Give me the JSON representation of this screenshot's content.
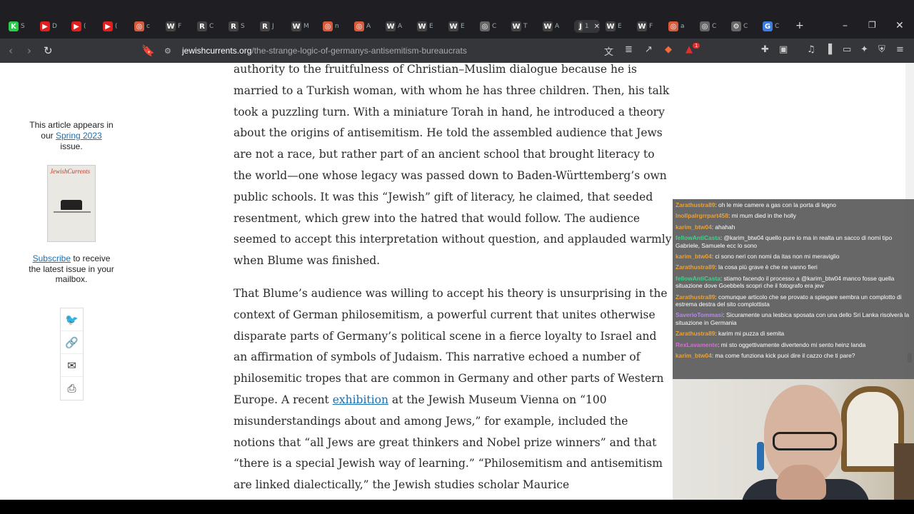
{
  "browser": {
    "tabs": [
      {
        "icon": "K",
        "color": "#2bcc4a",
        "letter": "S"
      },
      {
        "icon": "▶",
        "color": "#e02020",
        "letter": "D"
      },
      {
        "icon": "▶",
        "color": "#e02020",
        "letter": "("
      },
      {
        "icon": "▶",
        "color": "#e02020",
        "letter": "("
      },
      {
        "icon": "◎",
        "color": "#d95a3a",
        "letter": "c"
      },
      {
        "icon": "W",
        "color": "#444",
        "letter": "F"
      },
      {
        "icon": "R",
        "color": "#444",
        "letter": "C"
      },
      {
        "icon": "R",
        "color": "#444",
        "letter": "S"
      },
      {
        "icon": "R",
        "color": "#444",
        "letter": "J"
      },
      {
        "icon": "W",
        "color": "#444",
        "letter": "M"
      },
      {
        "icon": "◎",
        "color": "#d95a3a",
        "letter": "n"
      },
      {
        "icon": "◎",
        "color": "#d95a3a",
        "letter": "A"
      },
      {
        "icon": "W",
        "color": "#444",
        "letter": "A"
      },
      {
        "icon": "W",
        "color": "#444",
        "letter": "E"
      },
      {
        "icon": "W",
        "color": "#444",
        "letter": "E"
      },
      {
        "icon": "◎",
        "color": "#666",
        "letter": "C"
      },
      {
        "icon": "W",
        "color": "#444",
        "letter": "T"
      },
      {
        "icon": "W",
        "color": "#444",
        "letter": "A"
      },
      {
        "icon": "J",
        "color": "#555",
        "letter": "1",
        "active": true
      },
      {
        "icon": "W",
        "color": "#444",
        "letter": "E"
      },
      {
        "icon": "W",
        "color": "#444",
        "letter": "F"
      },
      {
        "icon": "◎",
        "color": "#d95a3a",
        "letter": "a"
      },
      {
        "icon": "◎",
        "color": "#666",
        "letter": "C"
      },
      {
        "icon": "⚙",
        "color": "#666",
        "letter": "C"
      },
      {
        "icon": "G",
        "color": "#3b7de0",
        "letter": "C"
      }
    ],
    "new_tab": "+",
    "url_host": "jewishcurrents.org",
    "url_path": "/the-strange-logic-of-germanys-antisemitism-bureaucrats",
    "brave_badge": "1"
  },
  "sidebar": {
    "appears_prefix": "This article appears in our",
    "issue_link": "Spring 2023",
    "issue_suffix": "issue.",
    "cover_logo": "JewishCurrents",
    "subscribe_link": "Subscribe",
    "subscribe_text": "to receive the latest issue in your mailbox."
  },
  "article": {
    "p1": "authority to the fruitfulness of Christian–Muslim dialogue because he is married to a Turkish woman, with whom he has three children. Then, his talk took a puzzling turn. With a miniature Torah in hand, he introduced a theory about the origins of antisemitism. He told the assembled audience that Jews are not a race, but rather part of an ancient school that brought literacy to the world—one whose legacy was passed down to Baden-Württemberg’s own public schools. It was this “Jewish” gift of literacy, he claimed, that seeded resentment, which grew into the hatred that would follow. The audience seemed to accept this interpretation without question, and applauded warmly when Blume was finished.",
    "p2_a": "That Blume’s audience was willing to accept his theory is unsurprising in the context of German philosemitism, a powerful current that unites otherwise disparate parts of Germany’s political scene in a fierce loyalty to Israel and an affirmation of symbols of Judaism. This narrative echoed a number of philosemitic tropes that are common in Germany and other parts of Western Europe. A recent",
    "p2_link": "exhibition",
    "p2_b": "at the Jewish Museum Vienna on “100 misunderstandings about and among Jews,” for example, included the notions that “all Jews are great thinkers and Nobel prize winners” and that “there is a special Jewish way of learning.” “Philosemitism and antisemitism are linked dialectically,” the Jewish studies scholar Maurice"
  },
  "chat": [
    {
      "user": "Zarathustra89",
      "color": "#e8a23a",
      "text": ": oh le mie camere a gas con la porta di legno"
    },
    {
      "user": "lnollpalrgrrpart458",
      "color": "#e8a23a",
      "text": ": mi mum died in the holly"
    },
    {
      "user": "karim_btw04",
      "color": "#e8a23a",
      "text": ": ahahah"
    },
    {
      "user": "fellowAntiCasta",
      "color": "#3fd28a",
      "text": ": @karim_btw04 quello pure io ma in realta un sacco di nomi tipo Gabriele, Samuele ecc lo sono"
    },
    {
      "user": "karim_btw04",
      "color": "#e8a23a",
      "text": ": ci sono neri con nomi da itas non mi meraviglio"
    },
    {
      "user": "Zarathustra89",
      "color": "#e8a23a",
      "text": ": la cosa più grave è che ne vanno fieri"
    },
    {
      "user": "fellowAntiCasta",
      "color": "#3fd28a",
      "text": ": stiamo facendo il processo a @karim_btw04 manco fosse quella situazione dove Goebbels scopri che il fotografo era jew"
    },
    {
      "user": "Zarathustra89",
      "color": "#e8a23a",
      "text": ": comunque articolo che se provato a spiegare sembra un complotto di estrema destra del sito complottista"
    },
    {
      "user": "SaverioTommasi",
      "color": "#b48be8",
      "text": ": Sicuramente una lesbica sposata con una dello Sri Lanka risolverà la situazione in Germania"
    },
    {
      "user": "Zarathustra89",
      "color": "#e8a23a",
      "text": ": karim mi puzza di semita"
    },
    {
      "user": "RexLavamente",
      "color": "#d86ad8",
      "text": ": mi sto oggettivamente divertendo mi sento heinz landa"
    },
    {
      "user": "karim_btw04",
      "color": "#e8a23a",
      "text": ": ma come funziona kick puoi dire il cazzo che ti pare?"
    }
  ]
}
